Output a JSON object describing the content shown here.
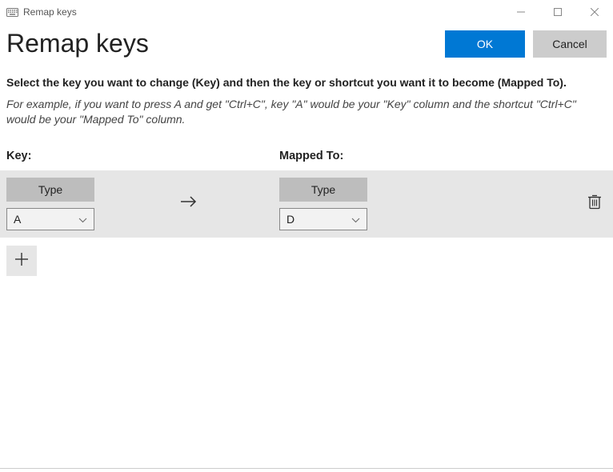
{
  "titlebar": {
    "title": "Remap keys"
  },
  "header": {
    "page_title": "Remap keys",
    "ok_label": "OK",
    "cancel_label": "Cancel"
  },
  "instructions": {
    "bold": "Select the key you want to change (Key) and then the key or shortcut you want it to become (Mapped To).",
    "example": "For example, if you want to press A and get \"Ctrl+C\", key \"A\" would be your \"Key\" column and the shortcut \"Ctrl+C\" would be your \"Mapped To\" column."
  },
  "columns": {
    "key": "Key:",
    "mapped": "Mapped To:"
  },
  "row": {
    "type_label_key": "Type",
    "type_label_mapped": "Type",
    "key_value": "A",
    "mapped_value": "D"
  },
  "colors": {
    "accent": "#0078d4"
  }
}
